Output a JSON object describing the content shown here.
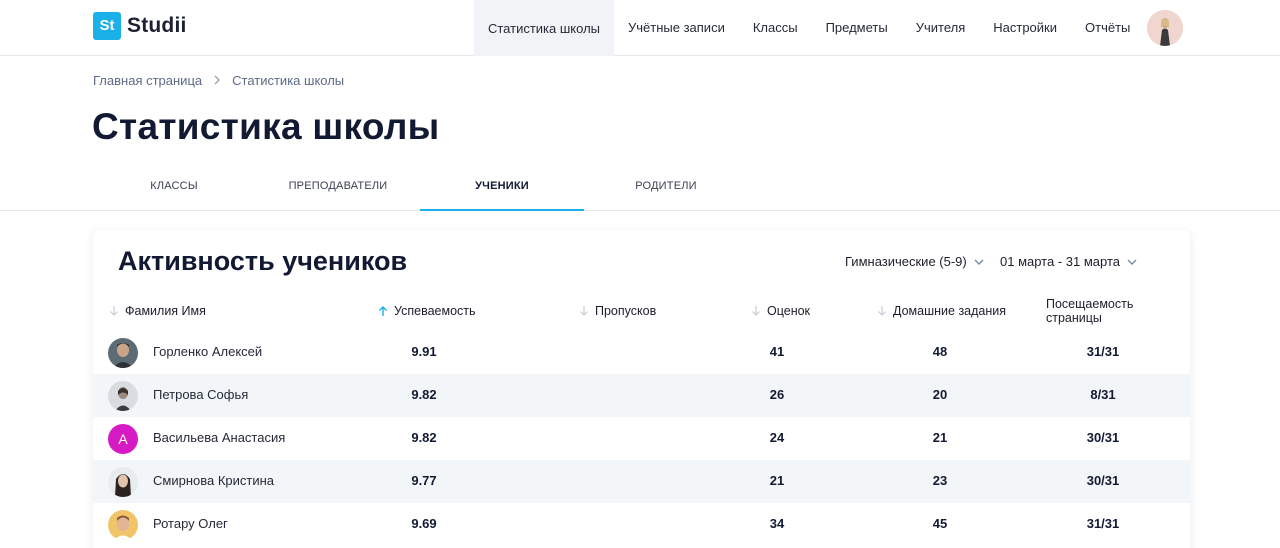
{
  "header": {
    "logo_badge": "St",
    "logo_text": "Studii",
    "nav": [
      {
        "label": "Статистика школы",
        "active": true
      },
      {
        "label": "Учётные записи"
      },
      {
        "label": "Классы"
      },
      {
        "label": "Предметы"
      },
      {
        "label": "Учителя"
      },
      {
        "label": "Настройки"
      },
      {
        "label": "Отчёты"
      }
    ]
  },
  "breadcrumb": {
    "home": "Главная страница",
    "separator": ">",
    "current": "Статистика школы"
  },
  "page_title": "Статистика школы",
  "tabs": [
    {
      "label": "Классы"
    },
    {
      "label": "Преподаватели"
    },
    {
      "label": "Ученики",
      "active": true
    },
    {
      "label": "Родители"
    }
  ],
  "card": {
    "title": "Активность учеников",
    "filter_group": "Гимназические (5-9)",
    "filter_period": "01 марта - 31 марта",
    "columns": {
      "name": "Фамилия Имя",
      "performance": "Успеваемость",
      "absences": "Пропусков",
      "grades": "Оценок",
      "homework": "Домашние задания",
      "attendance_line1": "Посещаемость",
      "attendance_line2": "страницы"
    },
    "rows": [
      {
        "name": "Горленко Алексей",
        "performance": "9.91",
        "absences": "",
        "grades": "41",
        "homework": "48",
        "attendance": "31/31"
      },
      {
        "name": "Петрова Софья",
        "performance": "9.82",
        "absences": "",
        "grades": "26",
        "homework": "20",
        "attendance": "8/31"
      },
      {
        "name": "Васильева Анастасия",
        "avatar_letter": "А",
        "performance": "9.82",
        "absences": "",
        "grades": "24",
        "homework": "21",
        "attendance": "30/31"
      },
      {
        "name": "Смирнова Кристина",
        "performance": "9.77",
        "absences": "",
        "grades": "21",
        "homework": "23",
        "attendance": "30/31"
      },
      {
        "name": "Ротару Олег",
        "performance": "9.69",
        "absences": "",
        "grades": "34",
        "homework": "45",
        "attendance": "31/31"
      }
    ]
  },
  "colors": {
    "accent": "#1ab0e8",
    "title": "#121a33",
    "row_alt": "#f3f6f9",
    "avatar_letter_bg": "#d61bc4"
  }
}
